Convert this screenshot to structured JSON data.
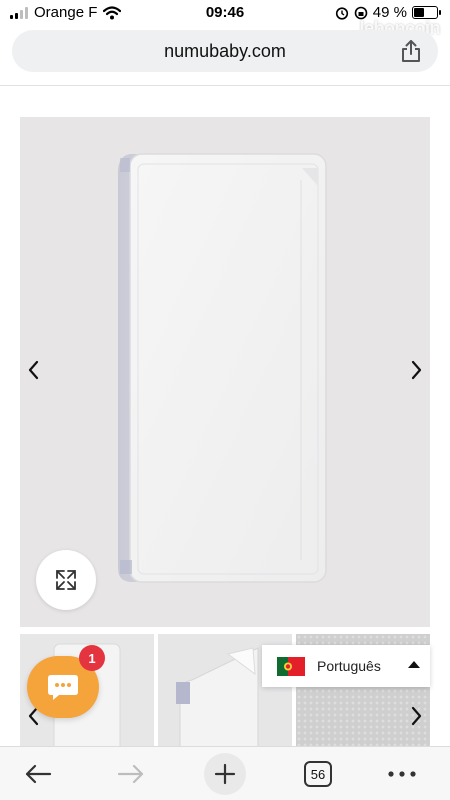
{
  "status_bar": {
    "carrier": "Orange F",
    "time": "09:46",
    "battery": "49 %",
    "battery_level": 0.49,
    "watermark": "leboncoin"
  },
  "browser": {
    "url": "numubaby.com",
    "tabs_count": "56"
  },
  "chat": {
    "badge_count": "1"
  },
  "language": {
    "label": "Português"
  },
  "icons": {
    "share": "share-icon",
    "expand": "expand-icon",
    "prev": "chevron-left-icon",
    "next": "chevron-right-icon",
    "chat": "chat-bubble-icon",
    "back": "back-arrow-icon",
    "forward": "forward-arrow-icon",
    "new_tab": "plus-icon",
    "more": "more-icon"
  },
  "colors": {
    "chat_button": "#f5a33b",
    "badge": "#e3343f",
    "urlbar": "#eef0f2",
    "image_background": "#e7e5e6"
  }
}
